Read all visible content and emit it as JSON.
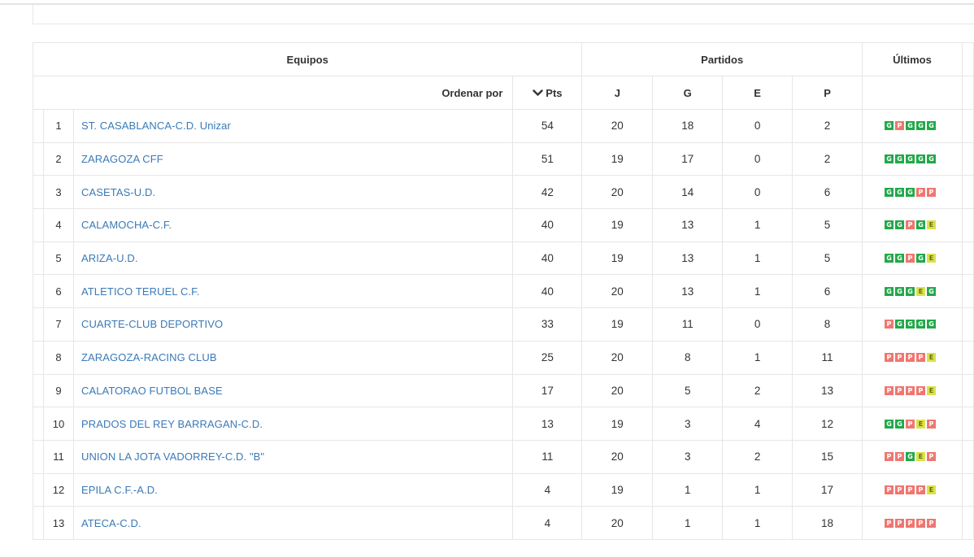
{
  "header": {
    "equipos": "Equipos",
    "partidos": "Partidos",
    "ultimos": "Últimos",
    "ordenar_por": "Ordenar por",
    "pts": "Pts",
    "j": "J",
    "g": "G",
    "e": "E",
    "p": "P"
  },
  "colors": {
    "win": "#22a84a",
    "loss": "#f07670",
    "draw": "#d9e24a",
    "link": "#3a7ab8"
  },
  "rows": [
    {
      "pos": "1",
      "team": "ST. CASABLANCA-C.D. Unizar",
      "pts": "54",
      "j": "20",
      "g": "18",
      "e": "0",
      "p": "2",
      "last": [
        "G",
        "P",
        "G",
        "G",
        "G"
      ]
    },
    {
      "pos": "2",
      "team": "ZARAGOZA CFF",
      "pts": "51",
      "j": "19",
      "g": "17",
      "e": "0",
      "p": "2",
      "last": [
        "G",
        "G",
        "G",
        "G",
        "G"
      ]
    },
    {
      "pos": "3",
      "team": "CASETAS-U.D.",
      "pts": "42",
      "j": "20",
      "g": "14",
      "e": "0",
      "p": "6",
      "last": [
        "G",
        "G",
        "G",
        "P",
        "P"
      ]
    },
    {
      "pos": "4",
      "team": "CALAMOCHA-C.F.",
      "pts": "40",
      "j": "19",
      "g": "13",
      "e": "1",
      "p": "5",
      "last": [
        "G",
        "G",
        "P",
        "G",
        "E"
      ]
    },
    {
      "pos": "5",
      "team": "ARIZA-U.D.",
      "pts": "40",
      "j": "19",
      "g": "13",
      "e": "1",
      "p": "5",
      "last": [
        "G",
        "G",
        "P",
        "G",
        "E"
      ]
    },
    {
      "pos": "6",
      "team": "ATLETICO TERUEL C.F.",
      "pts": "40",
      "j": "20",
      "g": "13",
      "e": "1",
      "p": "6",
      "last": [
        "G",
        "G",
        "G",
        "E",
        "G"
      ]
    },
    {
      "pos": "7",
      "team": "CUARTE-CLUB DEPORTIVO",
      "pts": "33",
      "j": "19",
      "g": "11",
      "e": "0",
      "p": "8",
      "last": [
        "P",
        "G",
        "G",
        "G",
        "G"
      ]
    },
    {
      "pos": "8",
      "team": "ZARAGOZA-RACING CLUB",
      "pts": "25",
      "j": "20",
      "g": "8",
      "e": "1",
      "p": "11",
      "last": [
        "P",
        "P",
        "P",
        "P",
        "E"
      ]
    },
    {
      "pos": "9",
      "team": "CALATORAO FUTBOL BASE",
      "pts": "17",
      "j": "20",
      "g": "5",
      "e": "2",
      "p": "13",
      "last": [
        "P",
        "P",
        "P",
        "P",
        "E"
      ]
    },
    {
      "pos": "10",
      "team": "PRADOS DEL REY BARRAGAN-C.D.",
      "pts": "13",
      "j": "19",
      "g": "3",
      "e": "4",
      "p": "12",
      "last": [
        "G",
        "G",
        "P",
        "E",
        "P"
      ]
    },
    {
      "pos": "11",
      "team": "UNION LA JOTA VADORREY-C.D. \"B\"",
      "pts": "11",
      "j": "20",
      "g": "3",
      "e": "2",
      "p": "15",
      "last": [
        "P",
        "P",
        "G",
        "E",
        "P"
      ]
    },
    {
      "pos": "12",
      "team": "EPILA C.F.-A.D.",
      "pts": "4",
      "j": "19",
      "g": "1",
      "e": "1",
      "p": "17",
      "last": [
        "P",
        "P",
        "P",
        "P",
        "E"
      ]
    },
    {
      "pos": "13",
      "team": "ATECA-C.D.",
      "pts": "4",
      "j": "20",
      "g": "1",
      "e": "1",
      "p": "18",
      "last": [
        "P",
        "P",
        "P",
        "P",
        "P"
      ]
    }
  ]
}
